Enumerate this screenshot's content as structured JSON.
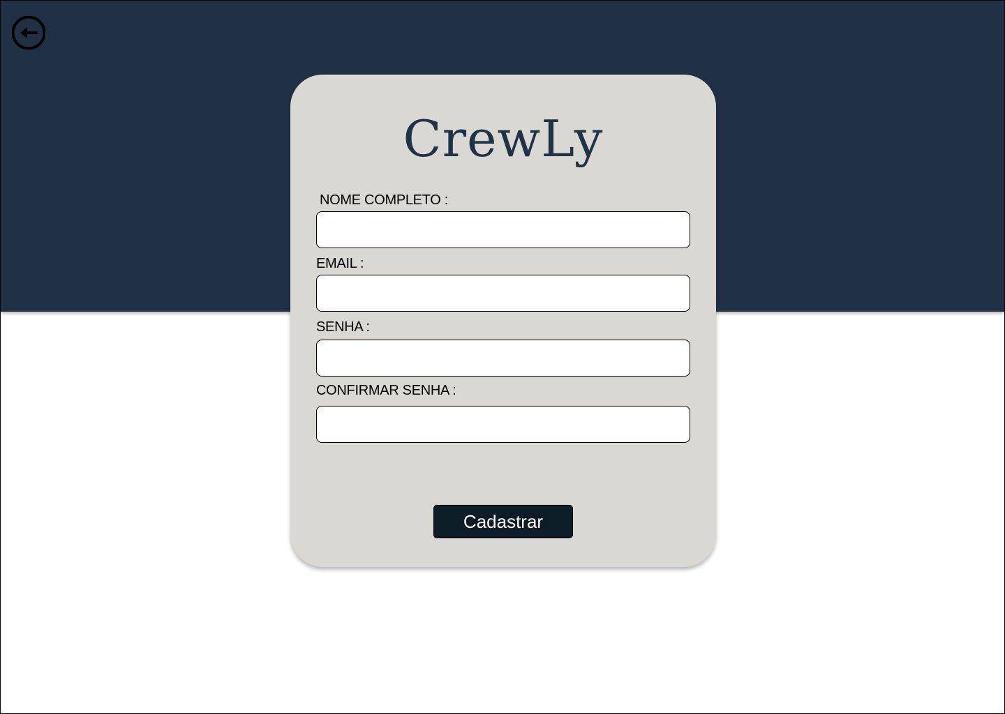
{
  "app": {
    "brand": "CrewLy"
  },
  "nav": {
    "back_icon": "arrow-left-circle-icon"
  },
  "form": {
    "fields": [
      {
        "label": " NOME COMPLETO :",
        "value": "",
        "placeholder": ""
      },
      {
        "label": "EMAIL :",
        "value": "",
        "placeholder": ""
      },
      {
        "label": "SENHA :",
        "value": "",
        "placeholder": ""
      },
      {
        "label": "CONFIRMAR SENHA :",
        "value": "",
        "placeholder": ""
      }
    ],
    "submit_label": "Cadastrar"
  },
  "colors": {
    "header_background": "#203145",
    "card_background": "#d9d8d2",
    "brand_text": "#1f3246",
    "button_background": "#0c1d27",
    "button_text": "#ffffff"
  }
}
